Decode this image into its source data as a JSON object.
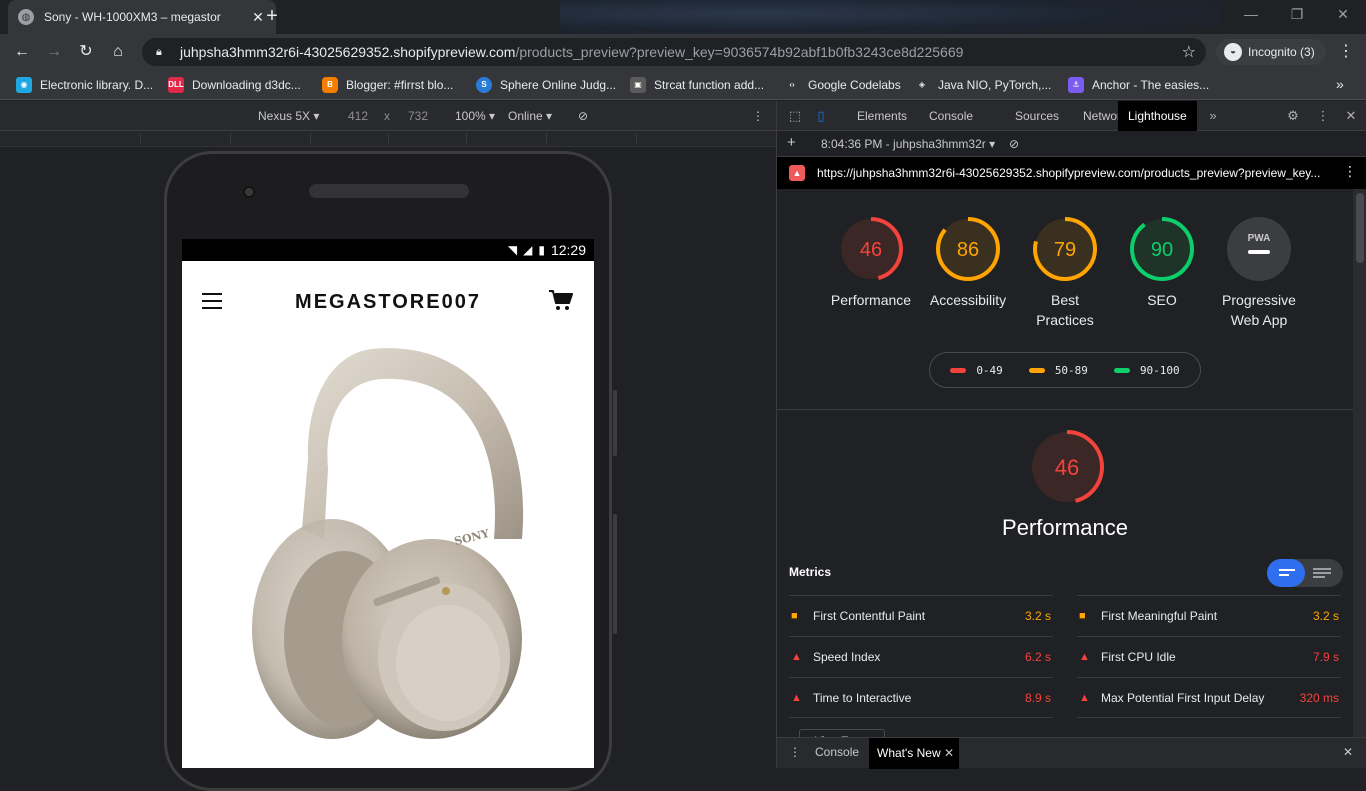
{
  "browser": {
    "tab_title": "Sony - WH-1000XM3 – megastor",
    "new_tab_label": "+",
    "url_host": "juhpsha3hmm32r6i-43025629352.shopifypreview.com",
    "url_rest": "/products_preview?preview_key=9036574b92abf1b0fb3243ce8d225669",
    "profile_label": "Incognito (3)",
    "bookmarks": [
      {
        "label": "Electronic library. D...",
        "color": "#1ea7e1",
        "glyph": "◉"
      },
      {
        "label": "Downloading d3dc...",
        "color": "#e0284b",
        "glyph": "DLL"
      },
      {
        "label": "Blogger: #firrst blo...",
        "color": "#f57d00",
        "glyph": "B"
      },
      {
        "label": "Sphere Online Judg...",
        "color": "#2b7bd8",
        "glyph": "S"
      },
      {
        "label": "Strcat function add...",
        "color": "#5b5b5b",
        "glyph": "▣"
      },
      {
        "label": "Google Codelabs",
        "color": "#35363a",
        "glyph": "‹›"
      },
      {
        "label": "Java NIO, PyTorch,...",
        "color": "#35363a",
        "glyph": "◈"
      },
      {
        "label": "Anchor - The easies...",
        "color": "#7b5cf0",
        "glyph": "⚓"
      }
    ]
  },
  "device_toolbar": {
    "device": "Nexus 5X",
    "width": "412",
    "times": "x",
    "height": "732",
    "zoom": "100%",
    "network": "Online"
  },
  "phone": {
    "time": "12:29",
    "brand": "MEGASTORE007",
    "product_brand_print": "SONY"
  },
  "devtools": {
    "tabs": [
      "Elements",
      "Console",
      "Sources",
      "Network",
      "Lighthouse"
    ],
    "active_tab": "Lighthouse",
    "more_tabs": "»",
    "report_time": "8:04:36 PM - juhpsha3hmm32r",
    "report_url": "https://juhpsha3hmm32r6i-43025629352.shopifypreview.com/products_preview?preview_key...",
    "pwa_badge": "PWA",
    "scores": [
      {
        "label": "Performance",
        "value": 46,
        "color": "#f4433c"
      },
      {
        "label": "Accessibility",
        "value": 86,
        "color": "#ffa400"
      },
      {
        "label": "Best Practices",
        "value": 79,
        "color": "#ffa400"
      },
      {
        "label": "SEO",
        "value": 90,
        "color": "#0cce6b"
      },
      {
        "label": "Progressive Web App",
        "value": null,
        "color": "#9aa0a6"
      }
    ],
    "legend": [
      {
        "range": "0-49",
        "color": "#f4433c"
      },
      {
        "range": "50-89",
        "color": "#ffa400"
      },
      {
        "range": "90-100",
        "color": "#0cce6b"
      }
    ],
    "perf_score": 46,
    "perf_title": "Performance",
    "metrics_heading": "Metrics",
    "metrics": [
      {
        "name": "First Contentful Paint",
        "value": "3.2 s",
        "level": "average"
      },
      {
        "name": "First Meaningful Paint",
        "value": "3.2 s",
        "level": "average"
      },
      {
        "name": "Speed Index",
        "value": "6.2 s",
        "level": "fail"
      },
      {
        "name": "First CPU Idle",
        "value": "7.9 s",
        "level": "fail"
      },
      {
        "name": "Time to Interactive",
        "value": "8.9 s",
        "level": "fail"
      },
      {
        "name": "Max Potential First Input Delay",
        "value": "320 ms",
        "level": "fail"
      }
    ],
    "view_trace": "View Trace",
    "drawer_tabs": [
      "Console",
      "What's New"
    ]
  },
  "colors": {
    "fail": "#f4433c",
    "average": "#ffa400",
    "pass": "#0cce6b"
  }
}
